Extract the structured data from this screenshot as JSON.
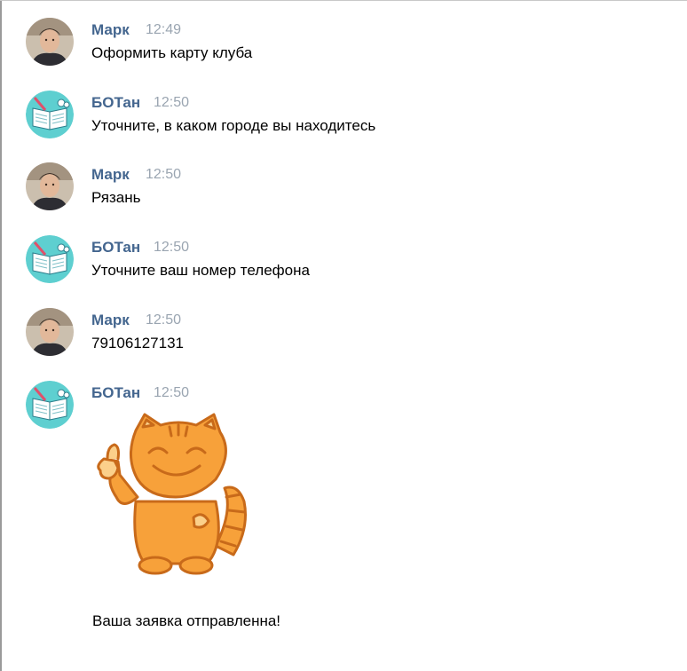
{
  "messages": [
    {
      "author": "Марк",
      "time": "12:49",
      "text": "Оформить карту клуба",
      "avatar": "user-photo"
    },
    {
      "author": "БОТан",
      "time": "12:50",
      "text": "Уточните, в каком городе вы находитесь",
      "avatar": "bot-book-icon"
    },
    {
      "author": "Марк",
      "time": "12:50",
      "text": "Рязань",
      "avatar": "user-photo"
    },
    {
      "author": "БОТан",
      "time": "12:50",
      "text": "Уточните ваш номер телефона",
      "avatar": "bot-book-icon"
    },
    {
      "author": "Марк",
      "time": "12:50",
      "text": "79106127131",
      "avatar": "user-photo"
    },
    {
      "author": "БОТан",
      "time": "12:50",
      "sticker": "cat-thumbs-up-sticker",
      "text": "Ваша заявка отправленна!",
      "avatar": "bot-book-icon"
    }
  ],
  "colors": {
    "author": "#44668f",
    "time": "#9aa5b1",
    "bot_avatar_bg": "#5ecfd0",
    "sticker_orange": "#f7a13a"
  }
}
